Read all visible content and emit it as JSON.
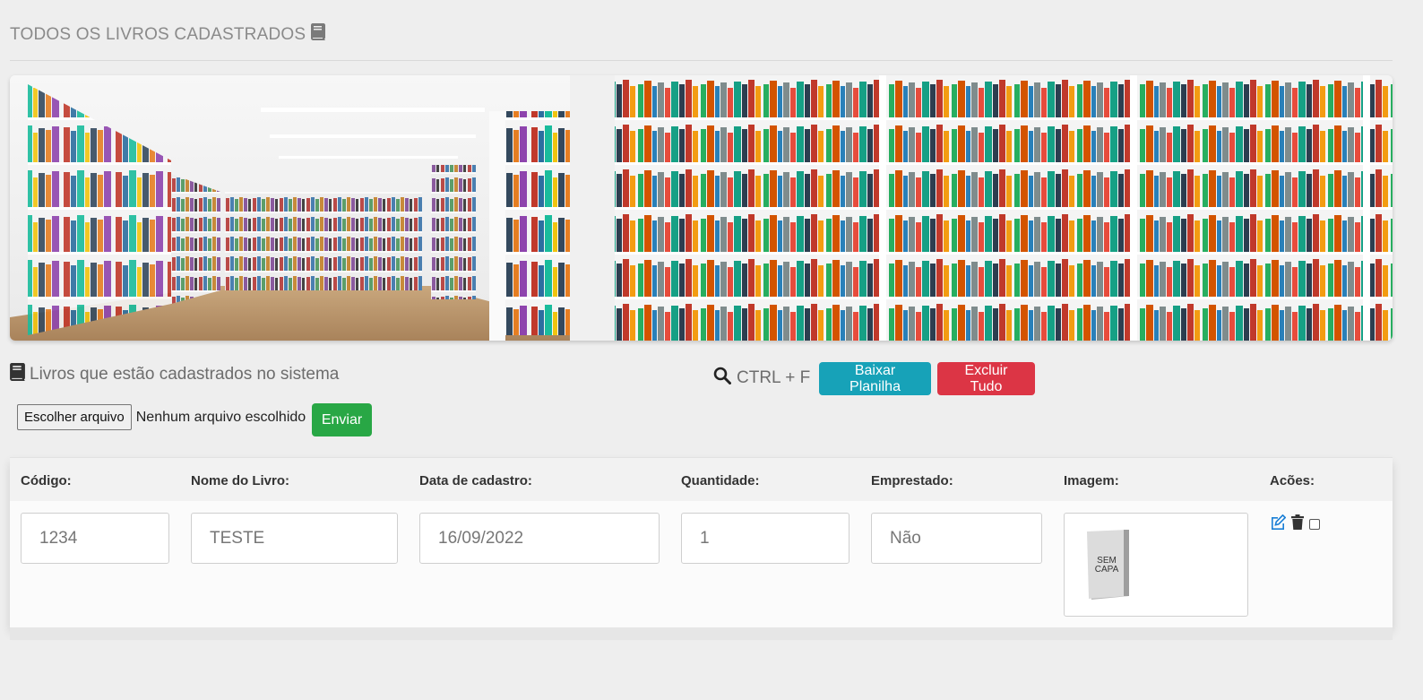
{
  "header": {
    "title": "TODOS OS LIVROS CADASTRADOS",
    "title_icon": "book-icon"
  },
  "toolbar": {
    "heading": "Livros que estão cadastrados no sistema",
    "heading_icon": "book-icon",
    "search_hint": "CTRL + F",
    "search_icon": "search-icon",
    "download_label": "Baixar Planilha",
    "delete_all_label": "Excluir Tudo",
    "download_color": "#17a2b8",
    "delete_color": "#dc3545"
  },
  "upload": {
    "choose_label": "Escolher arquivo",
    "no_file_label": "Nenhum arquivo escolhido",
    "send_label": "Enviar",
    "send_color": "#28a745"
  },
  "table": {
    "columns": [
      "Código:",
      "Nome do Livro:",
      "Data de cadastro:",
      "Quantidade:",
      "Emprestado:",
      "Imagem:",
      "Acões:"
    ],
    "rows": [
      {
        "code": "1234",
        "name": "TESTE",
        "date": "16/09/2022",
        "quantity": "1",
        "borrowed": "Não",
        "image_text_1": "SEM",
        "image_text_2": "CAPA",
        "actions": [
          "edit-icon",
          "trash-icon",
          "select-checkbox"
        ]
      }
    ]
  }
}
